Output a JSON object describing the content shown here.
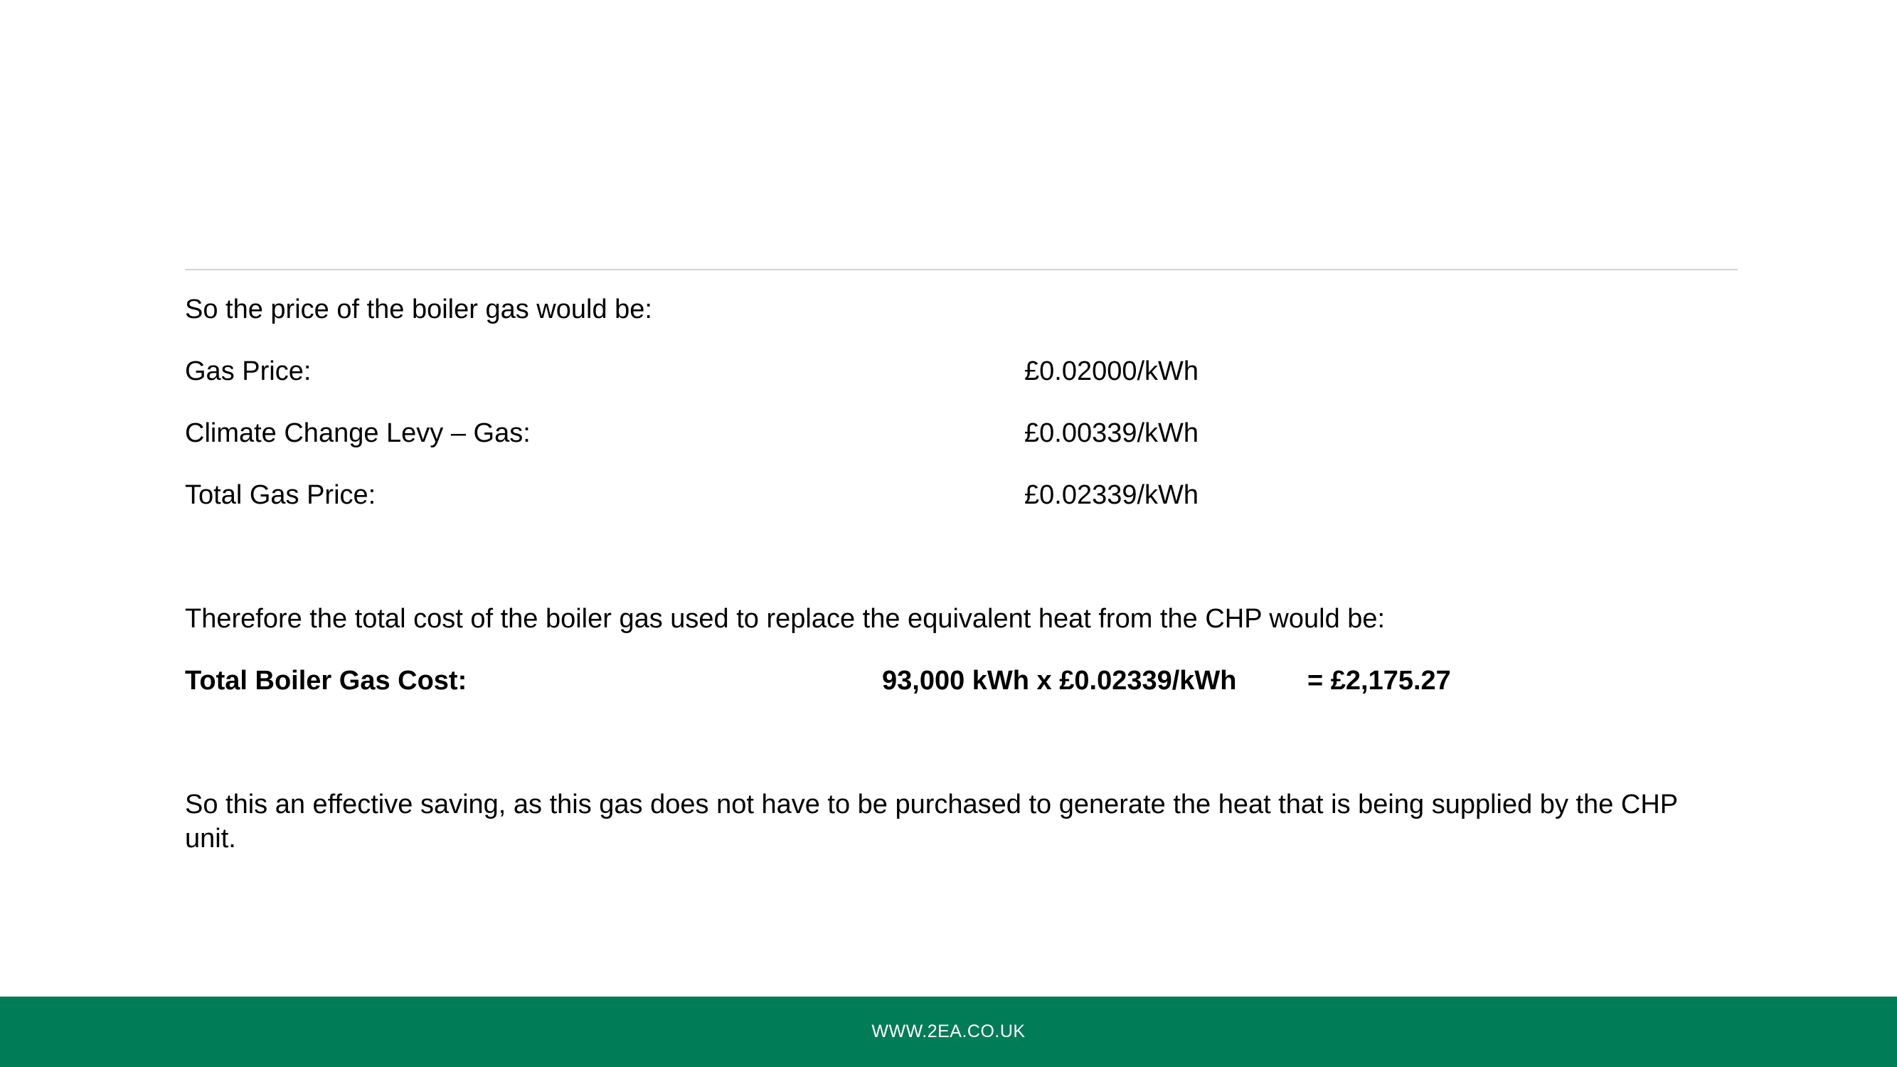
{
  "theme": {
    "footer_bg": "#007C56",
    "footer_text": "#ffffff",
    "divider": "#d4d4d4"
  },
  "intro": "So the price of the boiler gas would be:",
  "price_rows": [
    {
      "label": "Gas Price:",
      "value": "£0.02000/kWh"
    },
    {
      "label": "Climate Change Levy – Gas:",
      "value": "£0.00339/kWh"
    },
    {
      "label": "Total Gas Price:",
      "value": "£0.02339/kWh"
    }
  ],
  "therefore_text": "Therefore the total cost of the boiler gas used to replace the equivalent heat from the CHP would be:",
  "total": {
    "label": "Total Boiler Gas Cost:",
    "calculation": "93,000 kWh x £0.02339/kWh",
    "result": "= £2,175.27"
  },
  "conclusion": "So this an effective saving, as this gas does not have to be purchased to generate the heat that is being supplied by the CHP unit.",
  "footer": {
    "url": "WWW.2EA.CO.UK"
  }
}
